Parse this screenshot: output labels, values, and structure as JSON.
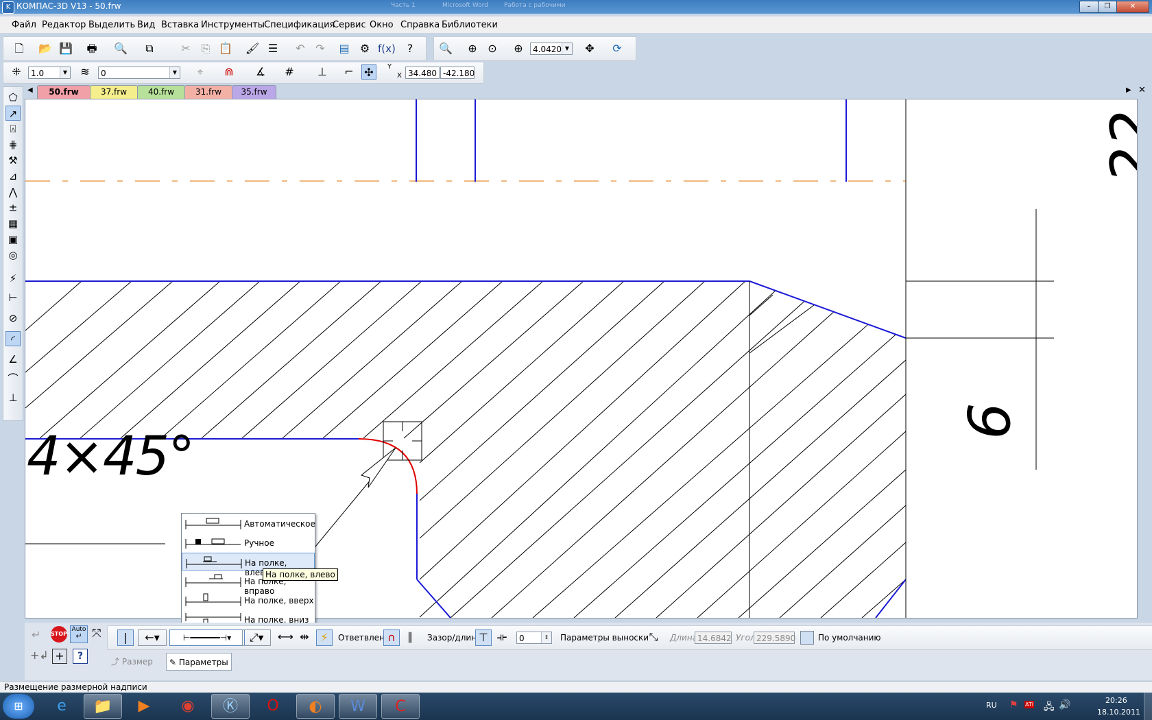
{
  "window": {
    "title": "КОМПАС-3D V13 - 50.frw",
    "bg_titles": [
      "Часть 1",
      "Microsoft Word",
      "Работа с рабочими"
    ]
  },
  "menu": [
    "Файл",
    "Редактор",
    "Выделить",
    "Вид",
    "Вставка",
    "Инструменты",
    "Спецификация",
    "Сервис",
    "Окно",
    "Справка",
    "Библиотеки"
  ],
  "toolbar": {
    "zoom_value": "4.0420",
    "step_value": "1.0",
    "layer_value": "0",
    "coord_y_label": "Y",
    "coord_x_label": "X",
    "coord_x": "34.480",
    "coord_y": "-42.180",
    "fx_label": "f(x)"
  },
  "tabs": [
    {
      "label": "50.frw",
      "color": "#f2a0a8",
      "active": true
    },
    {
      "label": "37.frw",
      "color": "#f4ee8c",
      "active": false
    },
    {
      "label": "40.frw",
      "color": "#b7e09a",
      "active": false
    },
    {
      "label": "31.frw",
      "color": "#f3b1a6",
      "active": false
    },
    {
      "label": "35.frw",
      "color": "#b9a7e8",
      "active": false
    }
  ],
  "drawing": {
    "dimension_text": "4×45°",
    "side_text": "6",
    "side_text_top": "22"
  },
  "dropdown": {
    "options": [
      "Автоматическое",
      "Ручное",
      "На полке, влево",
      "На полке, вправо",
      "На полке, вверх",
      "На полке, вниз"
    ],
    "selected_index": 2,
    "tooltip": "На полке, влево"
  },
  "panel": {
    "auto_label": "Auto",
    "stop_label": "STOP",
    "help_label": "?",
    "branches_label": "Ответвления",
    "gap_label": "Зазор/длина",
    "gap_value": "0",
    "leader_params_label": "Параметры выноски",
    "length_label": "Длина",
    "length_value": "14.6842",
    "angle_label": "Угол",
    "angle_value": "229.5890",
    "default_label": "По умолчанию",
    "tab_size": "Размер",
    "tab_params": "Параметры"
  },
  "status": {
    "text": "Размещение размерной надписи"
  },
  "taskbar": {
    "lang": "RU",
    "time": "20:26",
    "date": "18.10.2011",
    "tray_icons": [
      "flag-icon",
      "ati-icon",
      "network-icon",
      "volume-icon"
    ],
    "apps": [
      "start-orb",
      "ie-icon",
      "explorer-icon",
      "media-icon",
      "chrome-icon",
      "kompas-icon",
      "opera-icon",
      "firefox-icon",
      "word-icon",
      "kompas-alt-icon"
    ]
  },
  "colors": {
    "contour": "#1a1ad6",
    "axis": "#e07000",
    "red_arc": "#e00000",
    "selection": "#bcd6f4"
  }
}
